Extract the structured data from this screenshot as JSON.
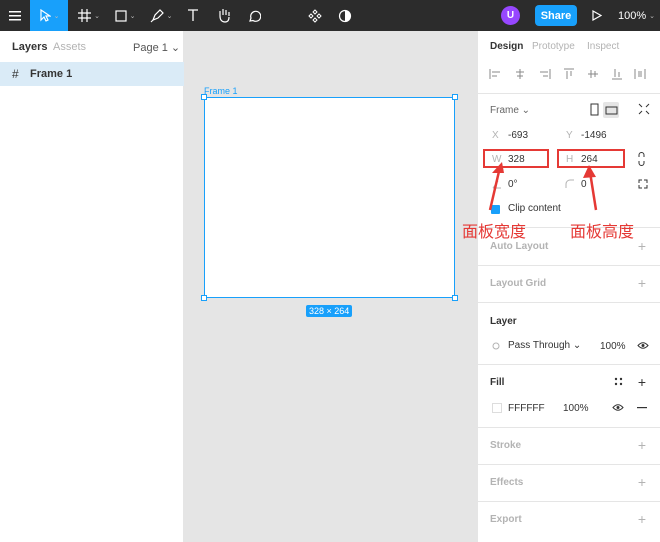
{
  "toolbar": {
    "avatar_initial": "U",
    "share_label": "Share",
    "zoom_label": "100%",
    "caret": "⌄"
  },
  "left_panel": {
    "tabs": [
      {
        "label": "Layers"
      },
      {
        "label": "Assets"
      }
    ],
    "page_selector": "Page 1 ⌄",
    "layers": [
      {
        "name": "Frame 1",
        "icon": "#"
      }
    ]
  },
  "canvas": {
    "frame_label": "Frame 1",
    "size_badge": "328 × 264"
  },
  "right_panel": {
    "tabs": [
      {
        "label": "Design"
      },
      {
        "label": "Prototype"
      },
      {
        "label": "Inspect"
      }
    ],
    "frame_selector": "Frame ⌄",
    "x_label": "X",
    "x_value": "-693",
    "y_label": "Y",
    "y_value": "-1496",
    "w_label": "W",
    "w_value": "328",
    "h_label": "H",
    "h_value": "264",
    "rotation_value": "0°",
    "radius_value": "0",
    "clip_content_label": "Clip content",
    "sections": {
      "auto_layout": "Auto Layout",
      "layout_grid": "Layout Grid",
      "layer": "Layer",
      "fill": "Fill",
      "stroke": "Stroke",
      "effects": "Effects",
      "export": "Export"
    },
    "layer_blend": "Pass Through ⌄",
    "layer_opacity": "100%",
    "fill_hex": "FFFFFF",
    "fill_opacity": "100%"
  },
  "annotations": {
    "width_note": "面板宽度",
    "height_note": "面板高度"
  },
  "colors": {
    "accent": "#18a0fb",
    "toolbar_bg": "#2c2c2c",
    "annotation": "#e53935",
    "avatar": "#9747ff"
  }
}
